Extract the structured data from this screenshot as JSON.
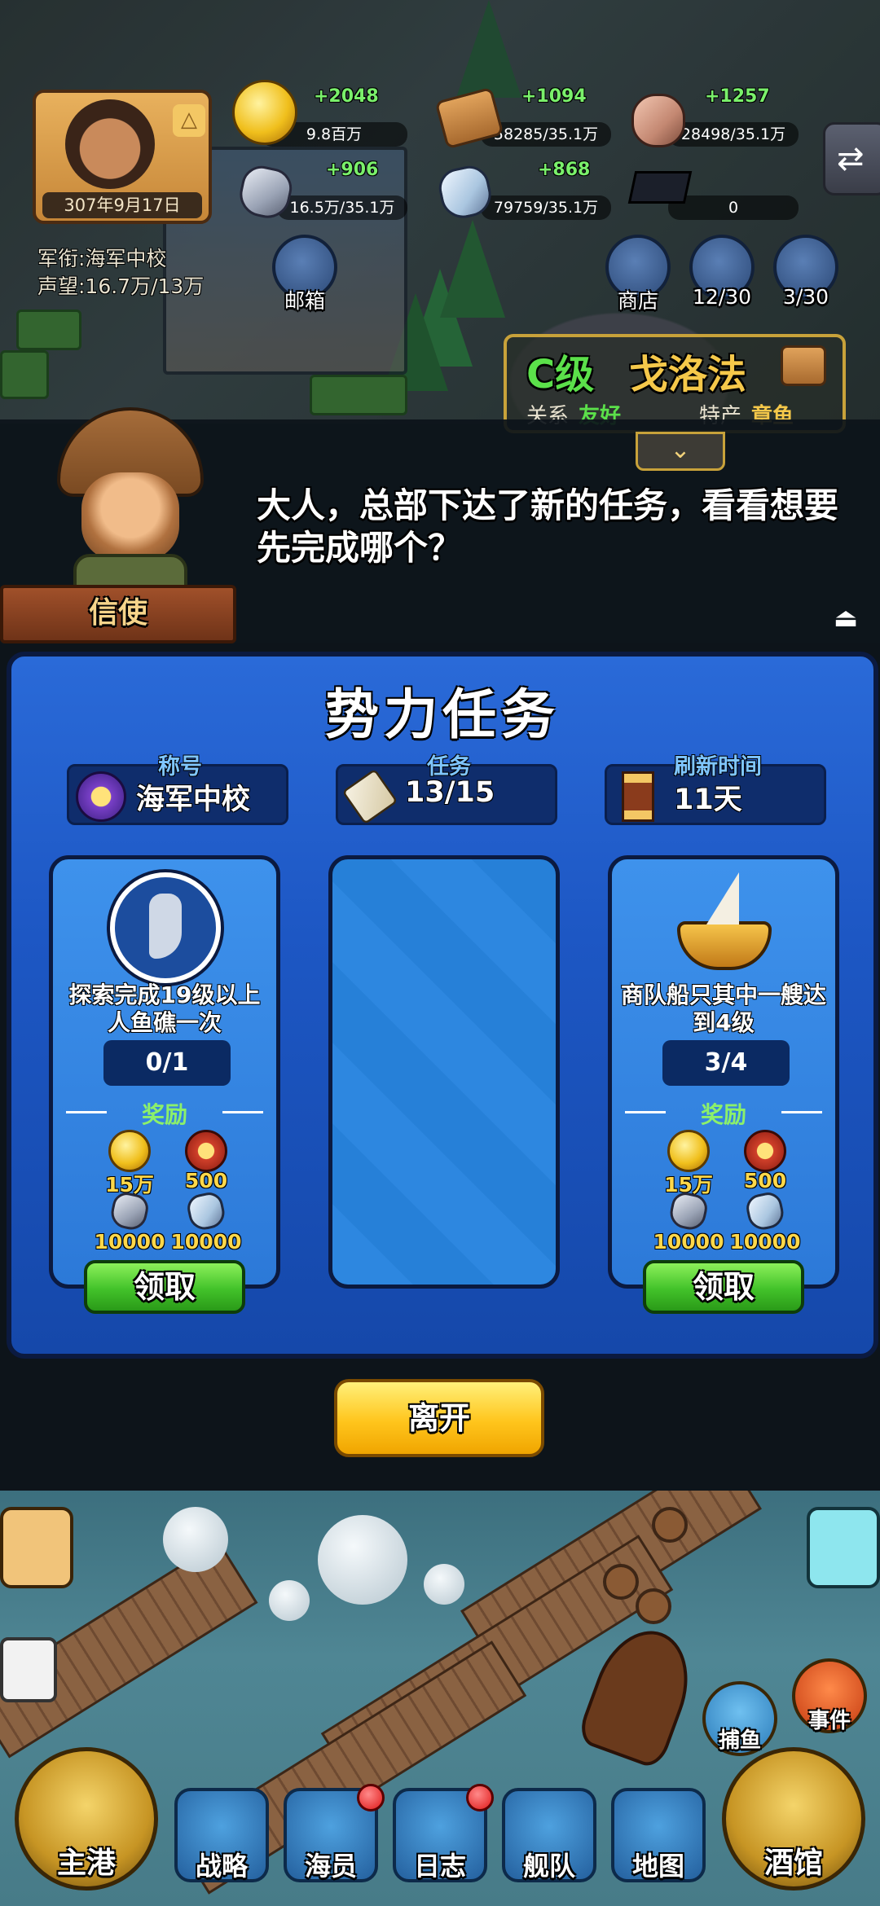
{
  "player": {
    "date": "307年9月17日",
    "rank_line": "军衔:海军中校",
    "fame_line": "声望:16.7万/13万"
  },
  "resources": {
    "gold": {
      "gain": "+2048",
      "amount": "9.8百万"
    },
    "wood": {
      "gain": "+1094",
      "amount": "58285/35.1万"
    },
    "stone": {
      "gain": "+1257",
      "amount": "28498/35.1万"
    },
    "iron": {
      "gain": "+906",
      "amount": "16.5万/35.1万"
    },
    "crystal": {
      "gain": "+868",
      "amount": "79759/35.1万"
    },
    "scholar": {
      "amount": "0"
    }
  },
  "hud_buttons": {
    "mail": "邮箱",
    "shop": "商店",
    "books": "12/30",
    "crew": "3/30"
  },
  "town": {
    "grade": "C级",
    "name": "戈洛法",
    "relation_label": "关系",
    "relation_value": "友好",
    "specialty_label": "特产",
    "specialty_value": "章鱼",
    "expand_glyph": "⌄"
  },
  "dialog": {
    "speaker": "信使",
    "text": "大人，总部下达了新的任务，看看想要先完成哪个？",
    "skip_glyph": "⏏"
  },
  "panel": {
    "title": "势力任务",
    "stats": [
      {
        "label": "称号",
        "value": "海军中校"
      },
      {
        "label": "任务",
        "value": "13/15"
      },
      {
        "label": "刷新时间",
        "value": "11天"
      }
    ],
    "reward_label": "奖励",
    "cards": [
      {
        "desc": "探索完成19级以上人鱼礁一次",
        "progress": "0/1",
        "rewards": [
          "15万",
          "500",
          "10000",
          "10000"
        ],
        "claim": "领取"
      },
      {
        "desc": "商队船只其中一艘达到4级",
        "progress": "3/4",
        "rewards": [
          "15万",
          "500",
          "10000",
          "10000"
        ],
        "claim": "领取"
      }
    ]
  },
  "leave_button": "离开",
  "side_buttons": {
    "fishing": "捕鱼",
    "event": "事件"
  },
  "nav": {
    "home": "主港",
    "strategy": "战略",
    "crew": "海员",
    "log": "日志",
    "fleet": "舰队",
    "map": "地图",
    "tavern": "酒馆"
  },
  "colors": {
    "panel_blue": "#1d57c4",
    "claim_green": "#42c22a",
    "leave_yellow": "#ffc51c",
    "gain_green": "#7af06b",
    "reward_green": "#8cf06a"
  }
}
